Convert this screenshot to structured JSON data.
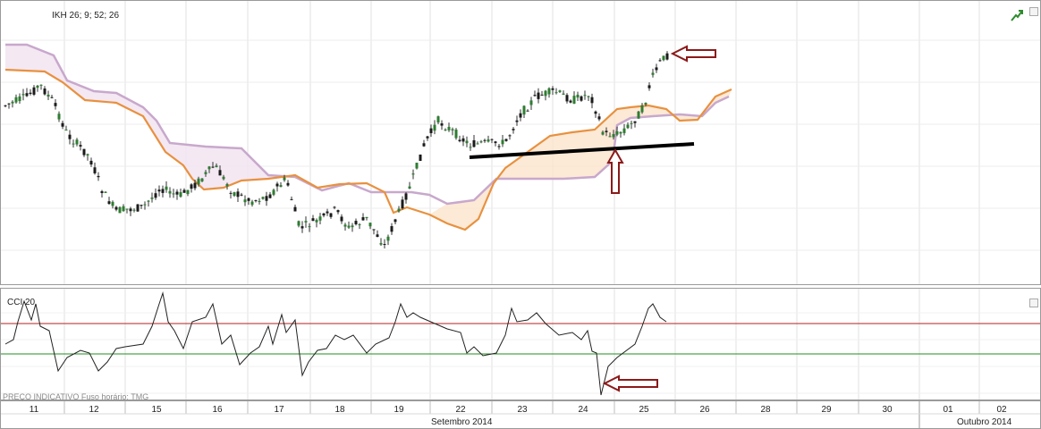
{
  "indicators": {
    "ikh_label": "IKH 26; 9; 52; 26",
    "cci_label": "CCI 20",
    "note": "PREÇO INDICATIVO    Fuso horário: TMG"
  },
  "axis": {
    "days": [
      "11",
      "12",
      "15",
      "16",
      "17",
      "18",
      "19",
      "22",
      "23",
      "24",
      "25",
      "26",
      "28",
      "29",
      "30",
      "01",
      "02"
    ],
    "months": [
      "Setembro 2014",
      "Outubro 2014"
    ]
  },
  "colors": {
    "kijun_line": "#e8913f",
    "senkou_line": "#c8a8cc",
    "cloud_fill_pink": "#f3e6f2",
    "cloud_fill_orange": "#fbe3cc",
    "trendline": "#000000",
    "arrow": "#8b1a1a",
    "cci_upper": "#b22222",
    "cci_lower": "#1f8f1f",
    "candle_up": "#2e7d32",
    "candle_down": "#1b1b1b"
  },
  "chart_data": [
    {
      "type": "candlestick",
      "title": "IKH 26; 9; 52; 26",
      "x": [
        "11",
        "12",
        "15",
        "16",
        "17",
        "18",
        "19",
        "22",
        "23",
        "24",
        "25",
        "26",
        "28",
        "29",
        "30",
        "01",
        "02"
      ],
      "price_index": [
        0.72,
        0.66,
        0.52,
        0.6,
        0.5,
        0.3,
        0.33,
        0.75,
        0.82,
        0.7,
        0.86,
        null,
        null,
        null,
        null,
        null,
        null
      ],
      "annotations": [
        "trendline below recent lows",
        "arrow pointing to high",
        "arrow pointing up to cloud cross"
      ]
    },
    {
      "type": "line",
      "title": "CCI 20",
      "x": [
        "11",
        "12",
        "15",
        "16",
        "17",
        "18",
        "19",
        "22",
        "23",
        "24",
        "25",
        "26",
        "28",
        "29",
        "30",
        "01",
        "02"
      ],
      "values": [
        60,
        -40,
        30,
        60,
        20,
        -10,
        50,
        30,
        40,
        -200,
        180,
        null,
        null,
        null,
        null,
        null,
        null
      ],
      "levels": [
        100,
        -100
      ]
    }
  ]
}
